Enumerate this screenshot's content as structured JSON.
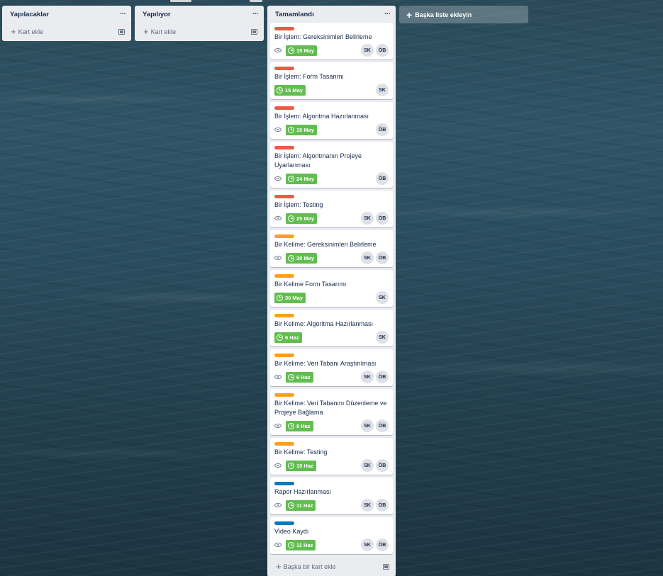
{
  "lists": [
    {
      "title": "Yapılacaklar",
      "add_card": "Kart ekle"
    },
    {
      "title": "Yapılıyor",
      "add_card": "Kart ekle"
    }
  ],
  "done_list": {
    "title": "Tamamlandı",
    "add_card": "Başka bir kart ekle",
    "cards": [
      {
        "title": "Bir İşlem: Gereksinimleri Belirleme",
        "label_color": "#eb5a46",
        "watch": true,
        "due": "15 May",
        "members": [
          "SK",
          "ÖB"
        ]
      },
      {
        "title": "Bir İşlem: Form Tasarımı",
        "label_color": "#eb5a46",
        "watch": false,
        "due": "15 May",
        "members": [
          "SK"
        ]
      },
      {
        "title": "Bir İşlem: Algoritma Hazırlanması",
        "label_color": "#eb5a46",
        "watch": true,
        "due": "15 May",
        "members": [
          "ÖB"
        ]
      },
      {
        "title": "Bir İşlem: Algoritmanın Projeye Uyarlanması",
        "label_color": "#eb5a46",
        "watch": true,
        "due": "24 May",
        "members": [
          "ÖB"
        ]
      },
      {
        "title": "Bir İşlem: Testing",
        "label_color": "#eb5a46",
        "watch": true,
        "due": "25 May",
        "members": [
          "SK",
          "ÖB"
        ]
      },
      {
        "title": "Bir Kelime: Gereksinimleri Belirleme",
        "label_color": "#ff9f1a",
        "watch": true,
        "due": "30 May",
        "members": [
          "SK",
          "ÖB"
        ]
      },
      {
        "title": "Bir Kelime Form Tasarımı",
        "label_color": "#ff9f1a",
        "watch": false,
        "due": "30 May",
        "members": [
          "SK"
        ]
      },
      {
        "title": "Bir Kelime: Algoritma Hazırlanması",
        "label_color": "#ff9f1a",
        "watch": false,
        "due": "6 Haz",
        "members": [
          "SK"
        ]
      },
      {
        "title": "Bir Kelime: Veri Tabanı Araştırılması",
        "label_color": "#ff9f1a",
        "watch": true,
        "due": "6 Haz",
        "members": [
          "SK",
          "ÖB"
        ]
      },
      {
        "title": "Bir Kelime: Veri Tabanını Düzenleme ve Projeye Bağlama",
        "label_color": "#ff9f1a",
        "watch": true,
        "due": "9 Haz",
        "members": [
          "SK",
          "ÖB"
        ]
      },
      {
        "title": "Bir Kelime: Testing",
        "label_color": "#ff9f1a",
        "watch": true,
        "due": "10 Haz",
        "members": [
          "SK",
          "ÖB"
        ]
      },
      {
        "title": "Rapor Hazırlanması",
        "label_color": "#0079bf",
        "watch": true,
        "due": "11 Haz",
        "members": [
          "SK",
          "ÖB"
        ]
      },
      {
        "title": "Video Kaydı",
        "label_color": "#0079bf",
        "watch": true,
        "due": "11 Haz",
        "members": [
          "SK",
          "ÖB"
        ]
      }
    ]
  },
  "add_list_label": "Başka liste ekleyin"
}
